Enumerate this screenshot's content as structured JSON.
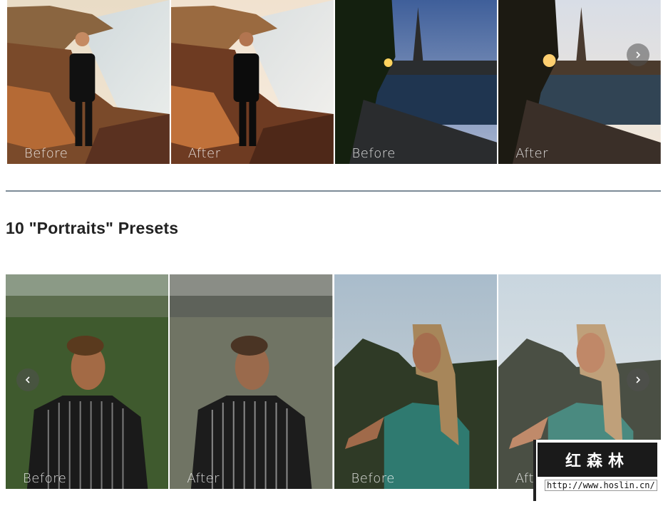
{
  "top_carousel": {
    "slides": [
      {
        "label": "Before"
      },
      {
        "label": "After"
      },
      {
        "label": "Before"
      },
      {
        "label": "After"
      }
    ],
    "next_icon": "chevron-right-icon"
  },
  "section": {
    "title": "10 \"Portraits\" Presets"
  },
  "bottom_carousel": {
    "slides": [
      {
        "label": "Before"
      },
      {
        "label": "After"
      },
      {
        "label": "Before"
      },
      {
        "label": "After"
      }
    ],
    "prev_icon": "chevron-left-icon",
    "next_icon": "chevron-right-icon"
  },
  "watermark": {
    "title": "红森林",
    "url": "http://www.hoslin.cn/"
  },
  "colors": {
    "divider": "#7d8b97",
    "title_text": "#222222"
  }
}
